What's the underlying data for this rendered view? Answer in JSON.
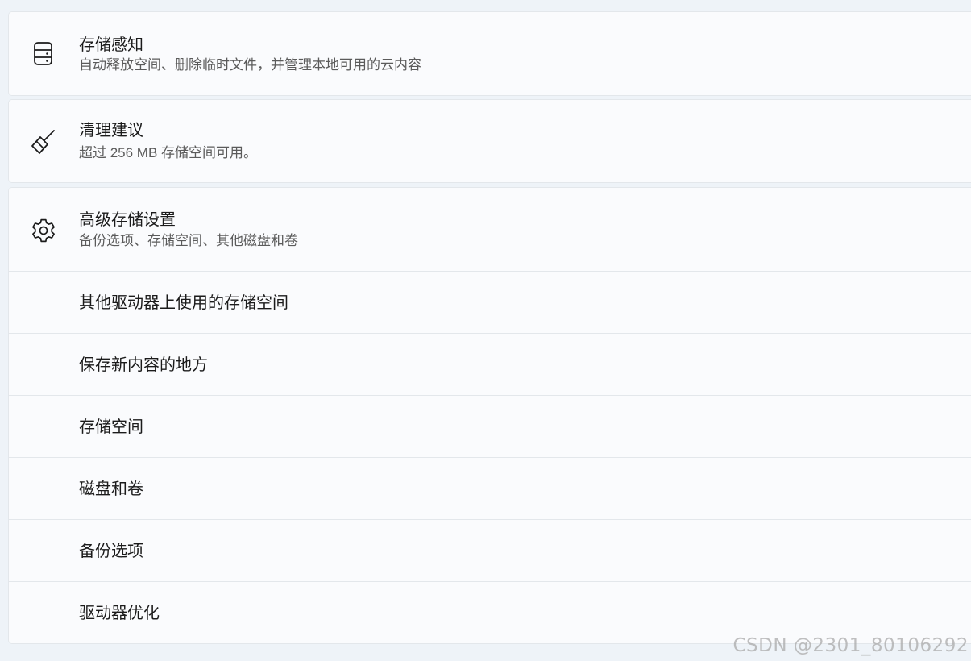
{
  "storage_sense": {
    "icon": "storage-drive-icon",
    "title": "存储感知",
    "description": "自动释放空间、删除临时文件，并管理本地可用的云内容"
  },
  "cleanup": {
    "icon": "broom-icon",
    "title": "清理建议",
    "description": "超过 256 MB 存储空间可用。"
  },
  "advanced": {
    "icon": "gear-icon",
    "title": "高级存储设置",
    "description": "备份选项、存储空间、其他磁盘和卷",
    "items": [
      {
        "label": "其他驱动器上使用的存储空间"
      },
      {
        "label": "保存新内容的地方"
      },
      {
        "label": "存储空间"
      },
      {
        "label": "磁盘和卷"
      },
      {
        "label": "备份选项"
      },
      {
        "label": "驱动器优化"
      }
    ]
  },
  "watermark": "CSDN @2301_80106292"
}
